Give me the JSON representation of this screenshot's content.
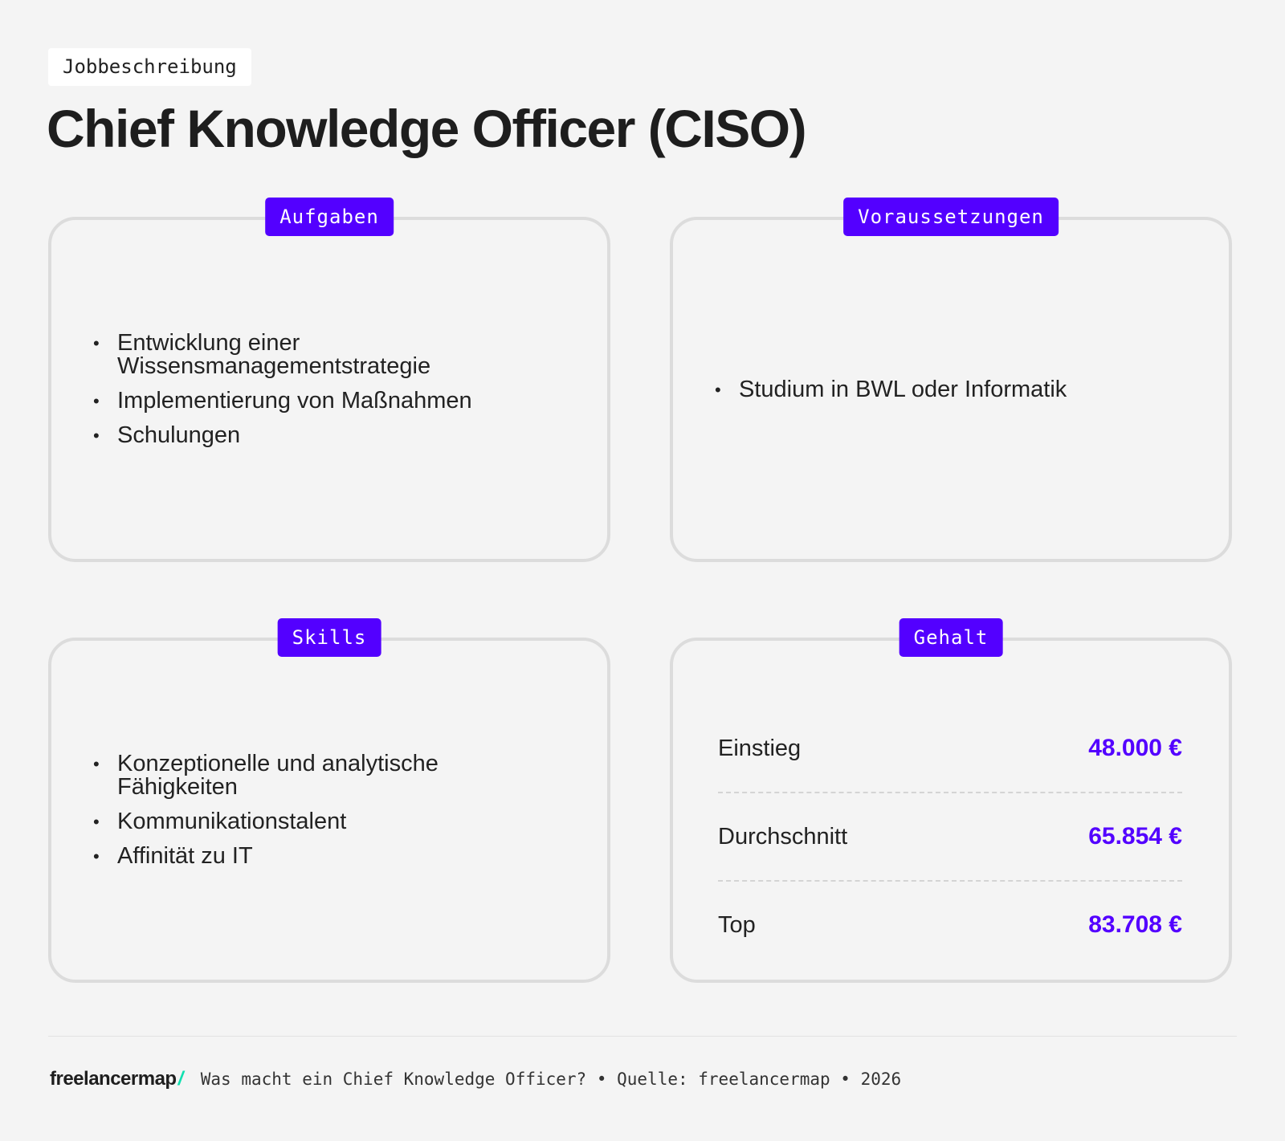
{
  "header": {
    "tag": "Jobbeschreibung",
    "title": "Chief Knowledge Officer (CISO)"
  },
  "cards": {
    "aufgaben": {
      "label": "Aufgaben",
      "items": [
        "Entwicklung einer Wissensmanagementstrategie",
        "Implementierung von Maßnahmen",
        "Schulungen"
      ]
    },
    "voraussetzungen": {
      "label": "Voraussetzungen",
      "items": [
        "Studium in BWL oder Informatik"
      ]
    },
    "skills": {
      "label": "Skills",
      "items": [
        "Konzeptionelle und analytische Fähigkeiten",
        "Kommunikationstalent",
        "Affinität zu IT"
      ]
    },
    "gehalt": {
      "label": "Gehalt",
      "rows": [
        {
          "label": "Einstieg",
          "value": "48.000 €"
        },
        {
          "label": "Durchschnitt",
          "value": "65.854 €"
        },
        {
          "label": "Top",
          "value": "83.708 €"
        }
      ]
    }
  },
  "footer": {
    "logo": "freelancermap",
    "logo_mark": "/",
    "text": "Was macht ein Chief Knowledge Officer? • Quelle: freelancermap • 2026"
  },
  "colors": {
    "accent": "#5300ff",
    "background": "#f4f4f4",
    "logo_mark": "#10e0b0"
  }
}
